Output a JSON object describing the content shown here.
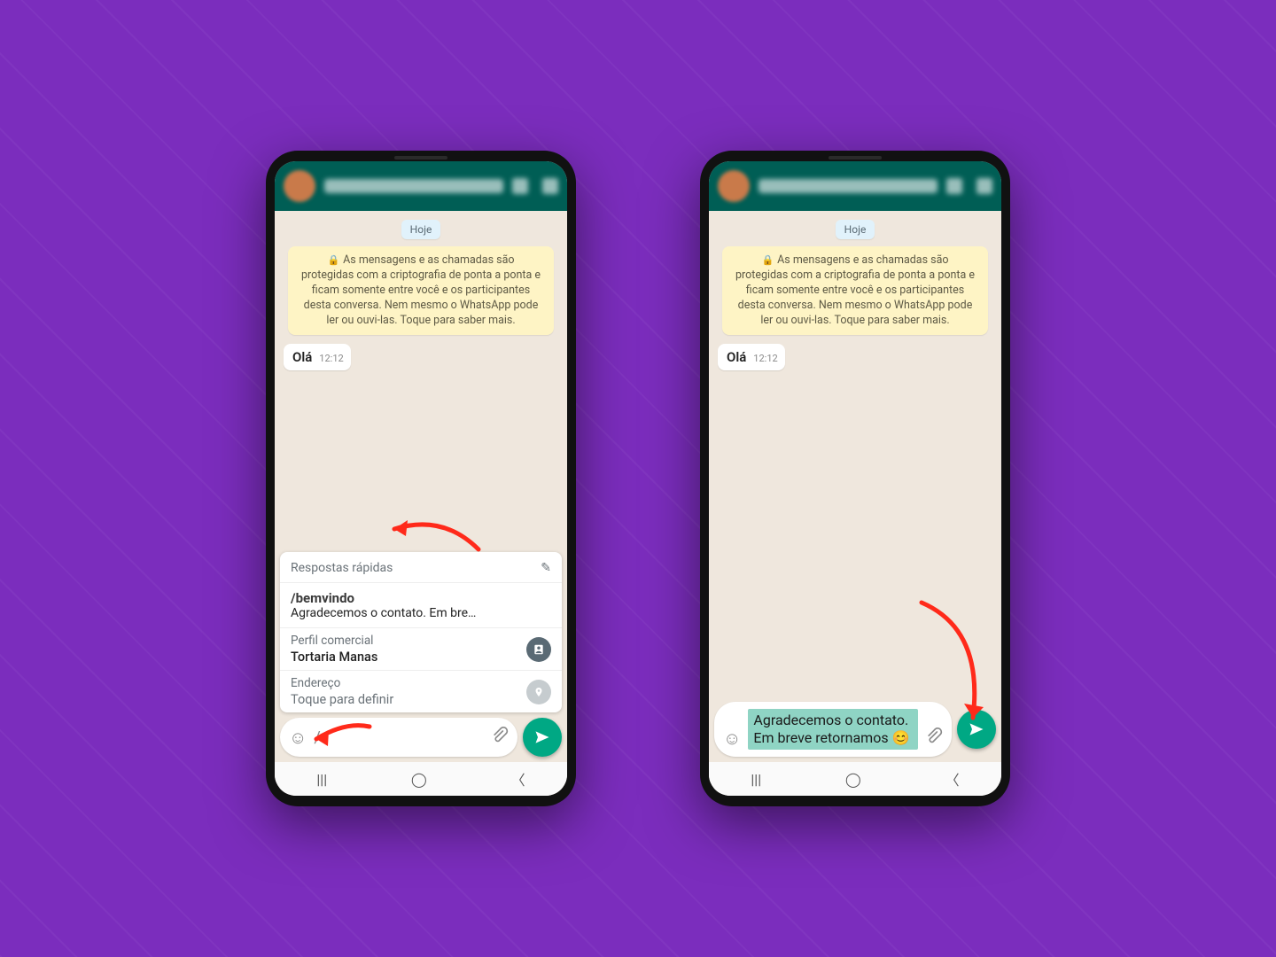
{
  "date_label": "Hoje",
  "encryption_notice": "As mensagens e as chamadas são protegidas com a criptografia de ponta a ponta e ficam somente entre você e os participantes desta conversa. Nem mesmo o WhatsApp pode ler ou ouvi-las. Toque para saber mais.",
  "incoming_message": {
    "text": "Olá",
    "time": "12:12"
  },
  "left_phone": {
    "quick_replies_title": "Respostas rápidas",
    "quick_reply": {
      "shortcut": "/bemvindo",
      "preview": "Agradecemos o contato. Em bre…"
    },
    "business_profile_label": "Perfil comercial",
    "business_profile_value": "Tortaria Manas",
    "address_label": "Endereço",
    "address_value": "Toque para definir",
    "input_value": "/"
  },
  "right_phone": {
    "input_value": "Agradecemos o contato. Em breve retornamos 😊"
  }
}
